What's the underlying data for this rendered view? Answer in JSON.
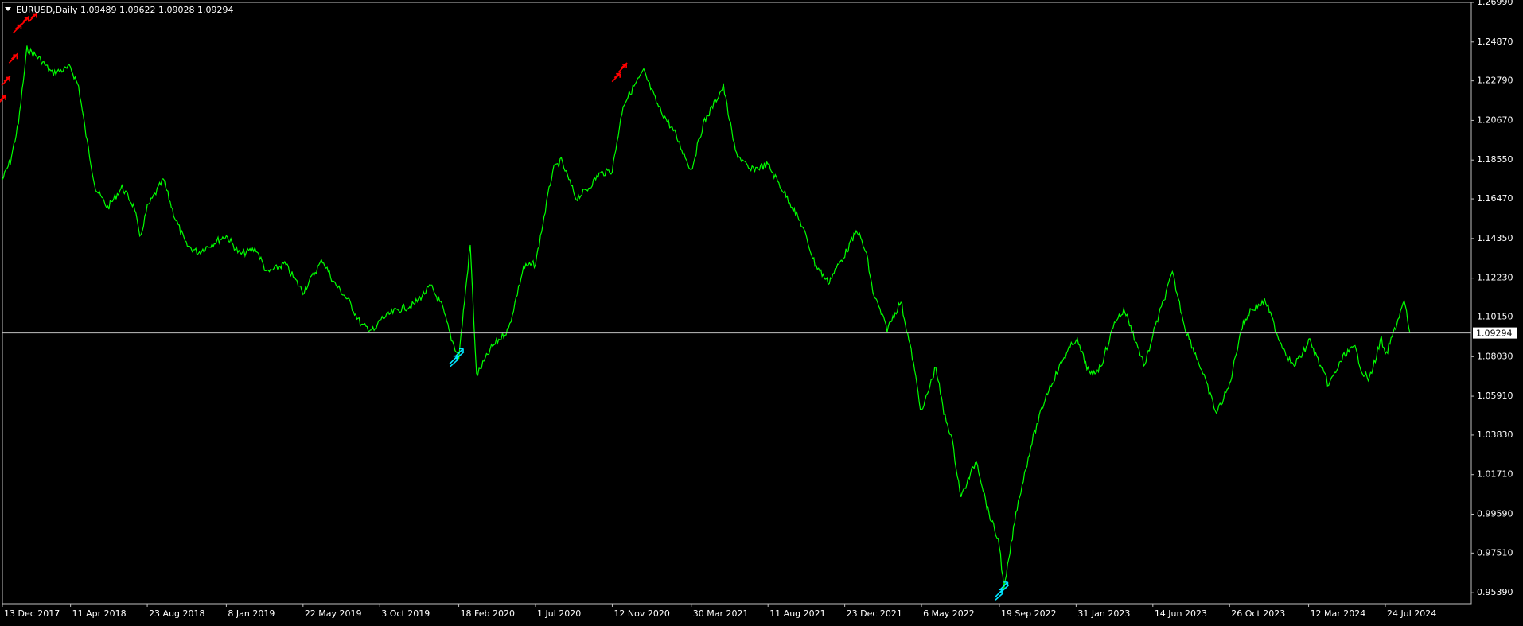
{
  "header": {
    "collapse_icon": "triangle-down-icon",
    "symbol": "EURUSD,Daily",
    "ohlc": "1.09489 1.09622 1.09028 1.09294"
  },
  "colors": {
    "background": "#000000",
    "price_line": "#00ff00",
    "sell_arrows": "#ff0000",
    "buy_arrows": "#00e5ff",
    "current_price_line": "#c0c0c0",
    "axis": "#c0c0c0",
    "text": "#ffffff"
  },
  "chart_data": {
    "type": "line",
    "title": "",
    "xlabel": "",
    "ylabel": "",
    "ylim": [
      0.948,
      1.2699
    ],
    "grid": false,
    "y_ticks": [
      "1.26990",
      "1.24870",
      "1.22790",
      "1.20670",
      "1.18550",
      "1.16470",
      "1.14350",
      "1.12230",
      "1.10150",
      "1.08030",
      "1.05910",
      "1.03830",
      "1.01710",
      "0.99590",
      "0.97510",
      "0.95390"
    ],
    "x_ticks": [
      "13 Dec 2017",
      "11 Apr 2018",
      "23 Aug 2018",
      "8 Jan 2019",
      "22 May 2019",
      "3 Oct 2019",
      "18 Feb 2020",
      "1 Jul 2020",
      "12 Nov 2020",
      "30 Mar 2021",
      "11 Aug 2021",
      "23 Dec 2021",
      "6 May 2022",
      "19 Sep 2022",
      "31 Jan 2023",
      "14 Jun 2023",
      "26 Oct 2023",
      "12 Mar 2024",
      "24 Jul 2024"
    ],
    "current_price": 1.09294,
    "current_price_label": "1.09294",
    "series": [
      {
        "x": [
          "2017-12-13",
          "2017-12-27",
          "2018-01-10",
          "2018-01-25",
          "2018-02-15",
          "2018-03-10",
          "2018-04-11",
          "2018-04-25",
          "2018-05-10",
          "2018-05-25",
          "2018-06-15",
          "2018-07-10",
          "2018-08-01",
          "2018-08-10",
          "2018-08-23",
          "2018-09-20",
          "2018-10-10",
          "2018-10-30",
          "2018-11-20",
          "2018-12-10",
          "2019-01-08",
          "2019-02-01",
          "2019-03-01",
          "2019-03-20",
          "2019-04-20",
          "2019-05-22",
          "2019-06-25",
          "2019-07-15",
          "2019-08-10",
          "2019-09-01",
          "2019-09-25",
          "2019-10-03",
          "2019-11-01",
          "2019-12-01",
          "2019-12-31",
          "2020-01-20",
          "2020-02-05",
          "2020-02-18",
          "2020-03-09",
          "2020-03-20",
          "2020-04-15",
          "2020-05-15",
          "2020-06-10",
          "2020-07-01",
          "2020-07-31",
          "2020-08-15",
          "2020-09-10",
          "2020-09-30",
          "2020-10-20",
          "2020-11-12",
          "2020-12-01",
          "2020-12-20",
          "2021-01-06",
          "2021-01-30",
          "2021-03-01",
          "2021-03-30",
          "2021-04-20",
          "2021-05-25",
          "2021-06-15",
          "2021-07-10",
          "2021-08-11",
          "2021-09-01",
          "2021-09-20",
          "2021-10-10",
          "2021-11-01",
          "2021-11-24",
          "2021-12-23",
          "2022-01-14",
          "2022-01-30",
          "2022-02-10",
          "2022-03-07",
          "2022-03-31",
          "2022-04-20",
          "2022-05-06",
          "2022-05-31",
          "2022-06-14",
          "2022-06-27",
          "2022-07-14",
          "2022-08-10",
          "2022-08-30",
          "2022-09-19",
          "2022-09-27",
          "2022-10-20",
          "2022-11-15",
          "2022-12-10",
          "2023-01-10",
          "2023-01-31",
          "2023-02-25",
          "2023-03-15",
          "2023-04-10",
          "2023-04-26",
          "2023-05-31",
          "2023-06-14",
          "2023-07-18",
          "2023-08-10",
          "2023-09-05",
          "2023-10-03",
          "2023-10-26",
          "2023-11-15",
          "2023-12-01",
          "2023-12-28",
          "2024-01-20",
          "2024-02-14",
          "2024-03-08",
          "2024-03-12",
          "2024-04-16",
          "2024-05-15",
          "2024-06-01",
          "2024-06-14",
          "2024-06-26",
          "2024-07-17",
          "2024-07-24",
          "2024-08-15",
          "2024-08-26",
          "2024-09-05"
        ],
        "y": [
          1.175,
          1.185,
          1.205,
          1.245,
          1.24,
          1.232,
          1.235,
          1.225,
          1.195,
          1.17,
          1.16,
          1.171,
          1.16,
          1.143,
          1.16,
          1.175,
          1.155,
          1.14,
          1.136,
          1.14,
          1.145,
          1.135,
          1.138,
          1.125,
          1.13,
          1.115,
          1.132,
          1.12,
          1.11,
          1.097,
          1.094,
          1.1,
          1.105,
          1.108,
          1.118,
          1.107,
          1.09,
          1.08,
          1.14,
          1.07,
          1.085,
          1.095,
          1.128,
          1.13,
          1.18,
          1.185,
          1.165,
          1.17,
          1.178,
          1.18,
          1.215,
          1.225,
          1.233,
          1.215,
          1.2,
          1.18,
          1.205,
          1.225,
          1.19,
          1.18,
          1.183,
          1.172,
          1.162,
          1.15,
          1.13,
          1.12,
          1.135,
          1.148,
          1.135,
          1.115,
          1.095,
          1.11,
          1.08,
          1.05,
          1.075,
          1.05,
          1.038,
          1.005,
          1.025,
          0.998,
          0.98,
          0.955,
          1.0,
          1.035,
          1.06,
          1.08,
          1.09,
          1.07,
          1.075,
          1.1,
          1.105,
          1.075,
          1.092,
          1.125,
          1.095,
          1.075,
          1.05,
          1.065,
          1.095,
          1.105,
          1.11,
          1.09,
          1.075,
          1.085,
          1.09,
          1.065,
          1.082,
          1.085,
          1.072,
          1.068,
          1.09,
          1.08,
          1.1,
          1.11,
          1.093
        ]
      }
    ],
    "sell_signals": [
      {
        "x": "2017-12-13",
        "y": 1.218
      },
      {
        "x": "2017-12-20",
        "y": 1.228
      },
      {
        "x": "2018-01-02",
        "y": 1.24
      },
      {
        "x": "2018-01-09",
        "y": 1.256
      },
      {
        "x": "2018-01-22",
        "y": 1.26
      },
      {
        "x": "2018-02-05",
        "y": 1.262
      },
      {
        "x": "2020-11-20",
        "y": 1.23
      },
      {
        "x": "2020-12-01",
        "y": 1.235
      }
    ],
    "buy_signals": [
      {
        "x": "2020-02-10",
        "y": 1.078
      },
      {
        "x": "2020-02-20",
        "y": 1.082
      },
      {
        "x": "2022-09-19",
        "y": 0.953
      },
      {
        "x": "2022-09-28",
        "y": 0.957
      }
    ]
  }
}
